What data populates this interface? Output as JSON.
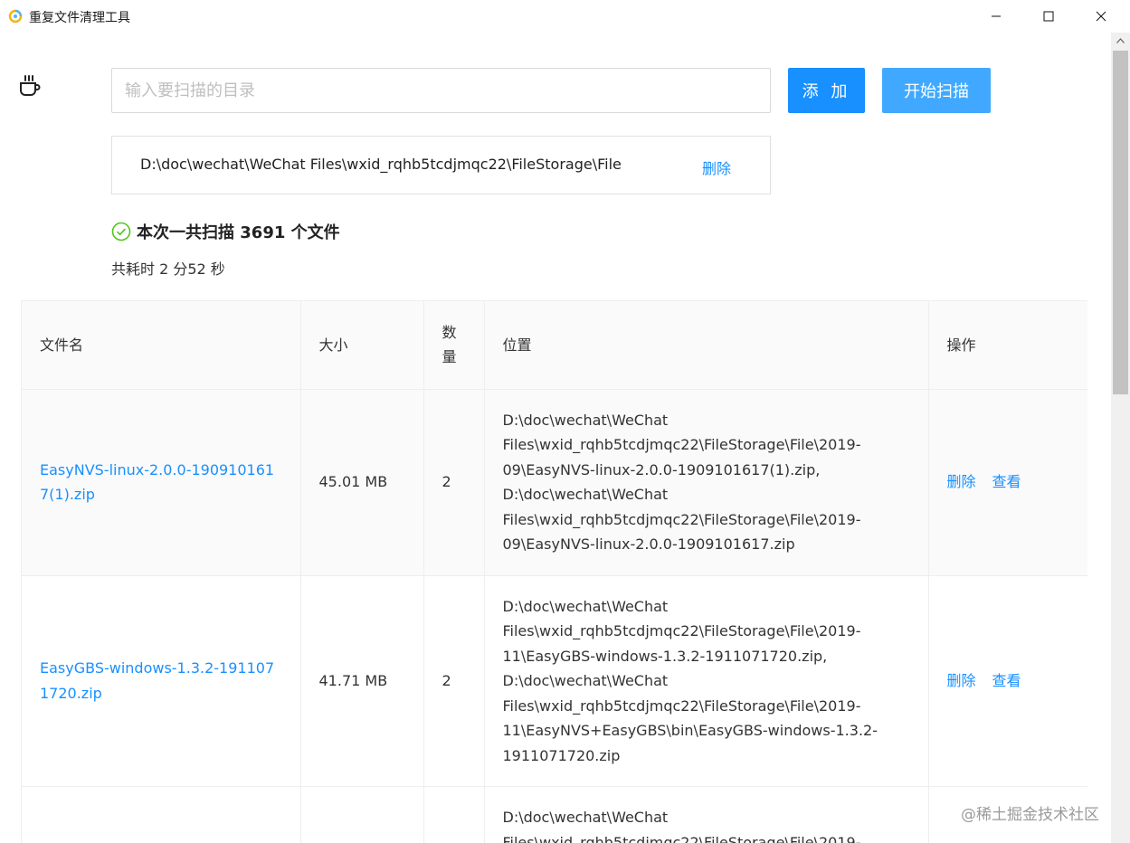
{
  "window": {
    "title": "重复文件清理工具"
  },
  "toolbar": {
    "input_placeholder": "输入要扫描的目录",
    "input_value": "",
    "add_label": "添 加",
    "scan_label": "开始扫描"
  },
  "directories": [
    {
      "path": "D:\\doc\\wechat\\WeChat Files\\wxid_rqhb5tcdjmqc22\\FileStorage\\File",
      "delete_label": "删除"
    }
  ],
  "summary": {
    "scan_text": "本次一共扫描 3691 个文件",
    "elapsed_text": "共耗时 2 分52 秒"
  },
  "table": {
    "headers": {
      "name": "文件名",
      "size": "大小",
      "count": "数量",
      "location": "位置",
      "actions": "操作"
    },
    "rows": [
      {
        "name": "EasyNVS-linux-2.0.0-1909101617(1).zip",
        "size": "45.01 MB",
        "count": "2",
        "location": "D:\\doc\\wechat\\WeChat Files\\wxid_rqhb5tcdjmqc22\\FileStorage\\File\\2019-09\\EasyNVS-linux-2.0.0-1909101617(1).zip, D:\\doc\\wechat\\WeChat Files\\wxid_rqhb5tcdjmqc22\\FileStorage\\File\\2019-09\\EasyNVS-linux-2.0.0-1909101617.zip",
        "delete_label": "删除",
        "view_label": "查看"
      },
      {
        "name": "EasyGBS-windows-1.3.2-1911071720.zip",
        "size": "41.71 MB",
        "count": "2",
        "location": "D:\\doc\\wechat\\WeChat Files\\wxid_rqhb5tcdjmqc22\\FileStorage\\File\\2019-11\\EasyGBS-windows-1.3.2-1911071720.zip, D:\\doc\\wechat\\WeChat Files\\wxid_rqhb5tcdjmqc22\\FileStorage\\File\\2019-11\\EasyNVS+EasyGBS\\bin\\EasyGBS-windows-1.3.2-1911071720.zip",
        "delete_label": "删除",
        "view_label": "查看"
      },
      {
        "name": "",
        "size": "",
        "count": "",
        "location": "D:\\doc\\wechat\\WeChat Files\\wxid_rqhb5tcdjmqc22\\FileStorage\\File\\2019-",
        "delete_label": "",
        "view_label": ""
      }
    ]
  },
  "watermark": "@稀土掘金技术社区",
  "colors": {
    "primary": "#1890ff",
    "primary_light": "#40a9ff",
    "success": "#52c41a"
  }
}
